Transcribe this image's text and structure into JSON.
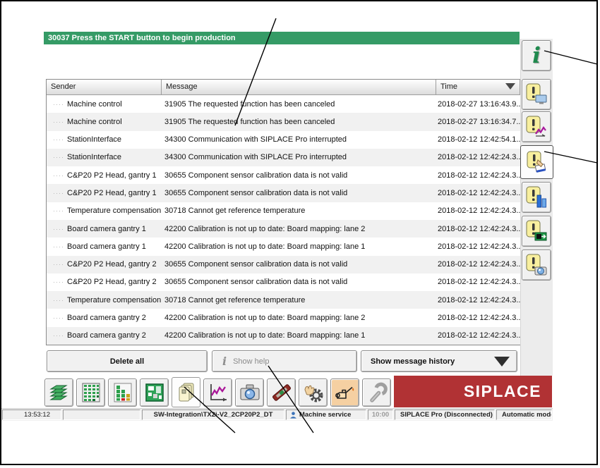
{
  "banner": {
    "text": "30037 Press the START button to begin production"
  },
  "table": {
    "columns": [
      "Sender",
      "Message",
      "Time"
    ],
    "sort": {
      "column": "Time",
      "direction": "desc"
    },
    "rows": [
      {
        "sender": "Machine control",
        "message": "31905 The requested function has been canceled",
        "time": "2018-02-27 13:16:43.9..."
      },
      {
        "sender": "Machine control",
        "message": "31905 The requested function has been canceled",
        "time": "2018-02-27 13:16:34.7..."
      },
      {
        "sender": "StationInterface",
        "message": "34300 Communication with SIPLACE Pro interrupted",
        "time": "2018-02-12 12:42:54.1..."
      },
      {
        "sender": "StationInterface",
        "message": "34300 Communication with SIPLACE Pro interrupted",
        "time": "2018-02-12 12:42:24.3..."
      },
      {
        "sender": "C&P20 P2 Head, gantry 1",
        "message": "30655 Component sensor calibration data is not valid",
        "time": "2018-02-12 12:42:24.3..."
      },
      {
        "sender": "C&P20 P2 Head, gantry 1",
        "message": "30655 Component sensor calibration data is not valid",
        "time": "2018-02-12 12:42:24.3..."
      },
      {
        "sender": "Temperature compensation f...",
        "message": "30718 Cannot get reference temperature",
        "time": "2018-02-12 12:42:24.3..."
      },
      {
        "sender": "Board camera gantry 1",
        "message": "42200 Calibration is not up to date: Board mapping: lane 2",
        "time": "2018-02-12 12:42:24.3..."
      },
      {
        "sender": "Board camera gantry 1",
        "message": "42200 Calibration is not up to date: Board mapping: lane 1",
        "time": "2018-02-12 12:42:24.3..."
      },
      {
        "sender": "C&P20 P2 Head, gantry 2",
        "message": "30655 Component sensor calibration data is not valid",
        "time": "2018-02-12 12:42:24.3..."
      },
      {
        "sender": "C&P20 P2 Head, gantry 2",
        "message": "30655 Component sensor calibration data is not valid",
        "time": "2018-02-12 12:42:24.3..."
      },
      {
        "sender": "Temperature compensation f...",
        "message": "30718 Cannot get reference temperature",
        "time": "2018-02-12 12:42:24.3..."
      },
      {
        "sender": "Board camera gantry 2",
        "message": "42200 Calibration is not up to date: Board mapping: lane 2",
        "time": "2018-02-12 12:42:24.3..."
      },
      {
        "sender": "Board camera gantry 2",
        "message": "42200 Calibration is not up to date: Board mapping: lane 1",
        "time": "2018-02-12 12:42:24.3..."
      }
    ]
  },
  "actions": {
    "delete_all": "Delete all",
    "show_help": "Show help",
    "show_message_history": "Show message history"
  },
  "sidebar": {
    "icons": [
      "info-icon",
      "message-monitor-icon",
      "message-statistics-icon",
      "message-interactive-icon",
      "message-levels-icon",
      "message-export-icon",
      "message-snapshot-icon"
    ],
    "selected": "message-interactive-icon"
  },
  "toolbar": {
    "icons": [
      "board-stack-icon",
      "feeder-table-icon",
      "component-bars-icon",
      "pcb-icon",
      "messages-icon",
      "statistics-icon",
      "camera-icon",
      "component-icon",
      "hand-gear-icon",
      "oil-can-icon",
      "wrench-icon"
    ],
    "selected": "messages-icon",
    "highlighted": "oil-can-icon"
  },
  "brand": {
    "logo_text": "SIPLACE"
  },
  "status_bar": {
    "clock": "13:53:12",
    "line_path": "SW-Integration\\TX2i-V2_2CP20P2_DT",
    "machine_service": "Machine service",
    "countdown": "10:00",
    "connection": "SIPLACE Pro (Disconnected)",
    "mode": "Automatic mode"
  },
  "colors": {
    "banner_green": "#359b66",
    "logo_red": "#b13234",
    "maintenance_highlight": "#f5d0a2",
    "row_alt": "#f1f1f1"
  }
}
